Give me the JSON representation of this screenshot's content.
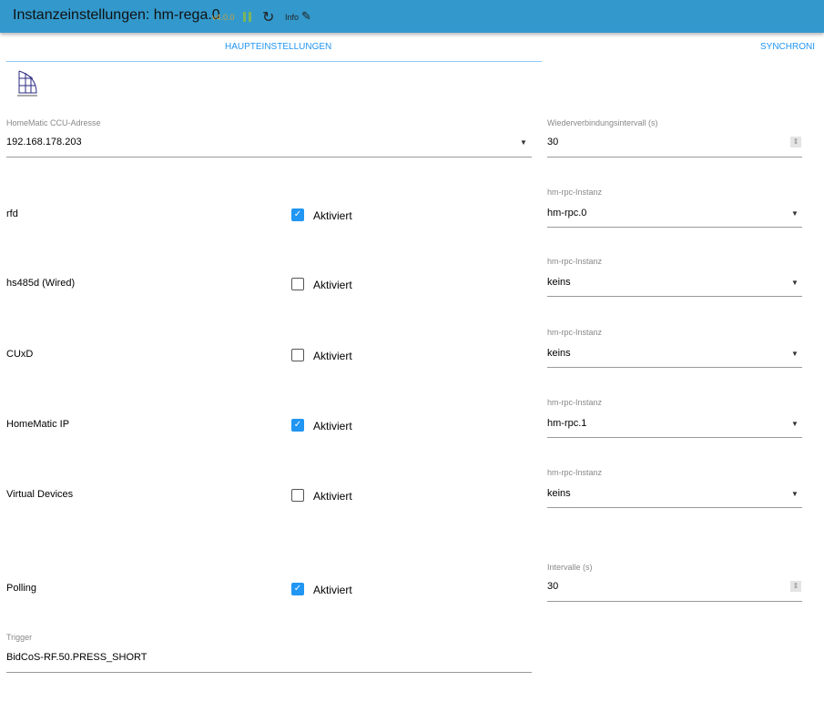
{
  "header": {
    "title": "Instanzeinstellungen: hm-rega.0",
    "version": "v4.0.0",
    "info": "Info",
    "icons": [
      "pause-icon",
      "reload-icon",
      "edit-icon"
    ]
  },
  "tabs": [
    {
      "label": "HAUPTEINSTELLUNGEN",
      "active": true
    },
    {
      "label": "SYNCHRONI"
    }
  ],
  "ccu": {
    "label": "HomeMatic CCU-Adresse",
    "value": "192.168.178.203"
  },
  "reconnect": {
    "label": "Wiederverbindungsintervall (s)",
    "value": "30"
  },
  "rows": [
    {
      "label": "rfd",
      "checkbox": "Aktiviert",
      "checked": true,
      "select_label": "hm-rpc-Instanz",
      "select_value": "hm-rpc.0"
    },
    {
      "label": "hs485d (Wired)",
      "checkbox": "Aktiviert",
      "checked": false,
      "select_label": "hm-rpc-Instanz",
      "select_value": "keins"
    },
    {
      "label": "CUxD",
      "checkbox": "Aktiviert",
      "checked": false,
      "select_label": "hm-rpc-Instanz",
      "select_value": "keins"
    },
    {
      "label": "HomeMatic IP",
      "checkbox": "Aktiviert",
      "checked": true,
      "select_label": "hm-rpc-Instanz",
      "select_value": "hm-rpc.1"
    },
    {
      "label": "Virtual Devices",
      "checkbox": "Aktiviert",
      "checked": false,
      "select_label": "hm-rpc-Instanz",
      "select_value": "keins"
    }
  ],
  "polling": {
    "label": "Polling",
    "checkbox": "Aktiviert",
    "checked": true,
    "interval_label": "Intervalle (s)",
    "interval_value": "30"
  },
  "trigger": {
    "label": "Trigger",
    "value": "BidCoS-RF.50.PRESS_SHORT"
  },
  "colors": {
    "header": "#3399cc",
    "accent": "#2196f3"
  }
}
